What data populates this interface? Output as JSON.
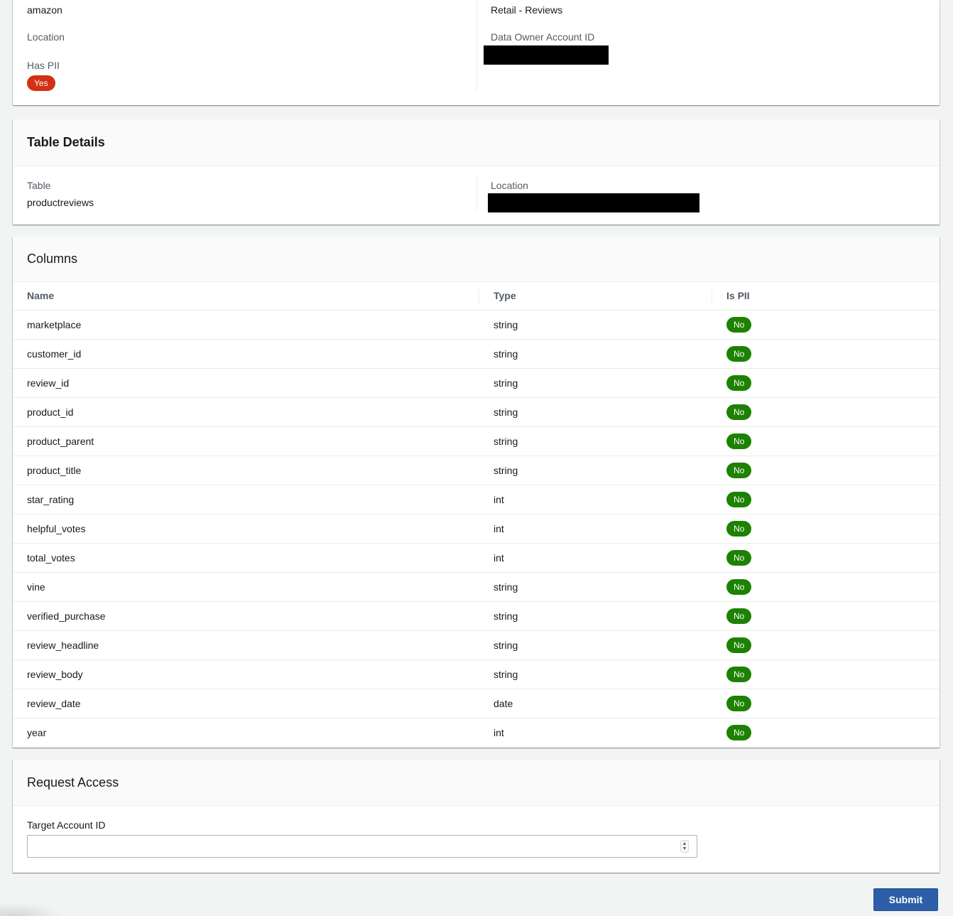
{
  "dataset_summary": {
    "left": {
      "value_top": "amazon",
      "location_label": "Location",
      "has_pii_label": "Has PII",
      "has_pii_badge": "Yes"
    },
    "right": {
      "value_top": "Retail - Reviews",
      "owner_label": "Data Owner Account ID"
    }
  },
  "table_details": {
    "title": "Table Details",
    "table_label": "Table",
    "table_value": "productreviews",
    "location_label": "Location"
  },
  "columns": {
    "title": "Columns",
    "headers": [
      "Name",
      "Type",
      "Is PII"
    ],
    "rows": [
      {
        "name": "marketplace",
        "type": "string",
        "pii": "No"
      },
      {
        "name": "customer_id",
        "type": "string",
        "pii": "No"
      },
      {
        "name": "review_id",
        "type": "string",
        "pii": "No"
      },
      {
        "name": "product_id",
        "type": "string",
        "pii": "No"
      },
      {
        "name": "product_parent",
        "type": "string",
        "pii": "No"
      },
      {
        "name": "product_title",
        "type": "string",
        "pii": "No"
      },
      {
        "name": "star_rating",
        "type": "int",
        "pii": "No"
      },
      {
        "name": "helpful_votes",
        "type": "int",
        "pii": "No"
      },
      {
        "name": "total_votes",
        "type": "int",
        "pii": "No"
      },
      {
        "name": "vine",
        "type": "string",
        "pii": "No"
      },
      {
        "name": "verified_purchase",
        "type": "string",
        "pii": "No"
      },
      {
        "name": "review_headline",
        "type": "string",
        "pii": "No"
      },
      {
        "name": "review_body",
        "type": "string",
        "pii": "No"
      },
      {
        "name": "review_date",
        "type": "date",
        "pii": "No"
      },
      {
        "name": "year",
        "type": "int",
        "pii": "No"
      }
    ]
  },
  "request_access": {
    "title": "Request Access",
    "target_label": "Target Account ID",
    "target_value": "",
    "spinner_up": "▲",
    "spinner_down": "▼",
    "submit_label": "Submit"
  },
  "colors": {
    "pii_yes": "#d13212",
    "pii_no": "#1d8102",
    "primary_button": "#2c5fa8",
    "page_background": "#f2f3f3"
  }
}
